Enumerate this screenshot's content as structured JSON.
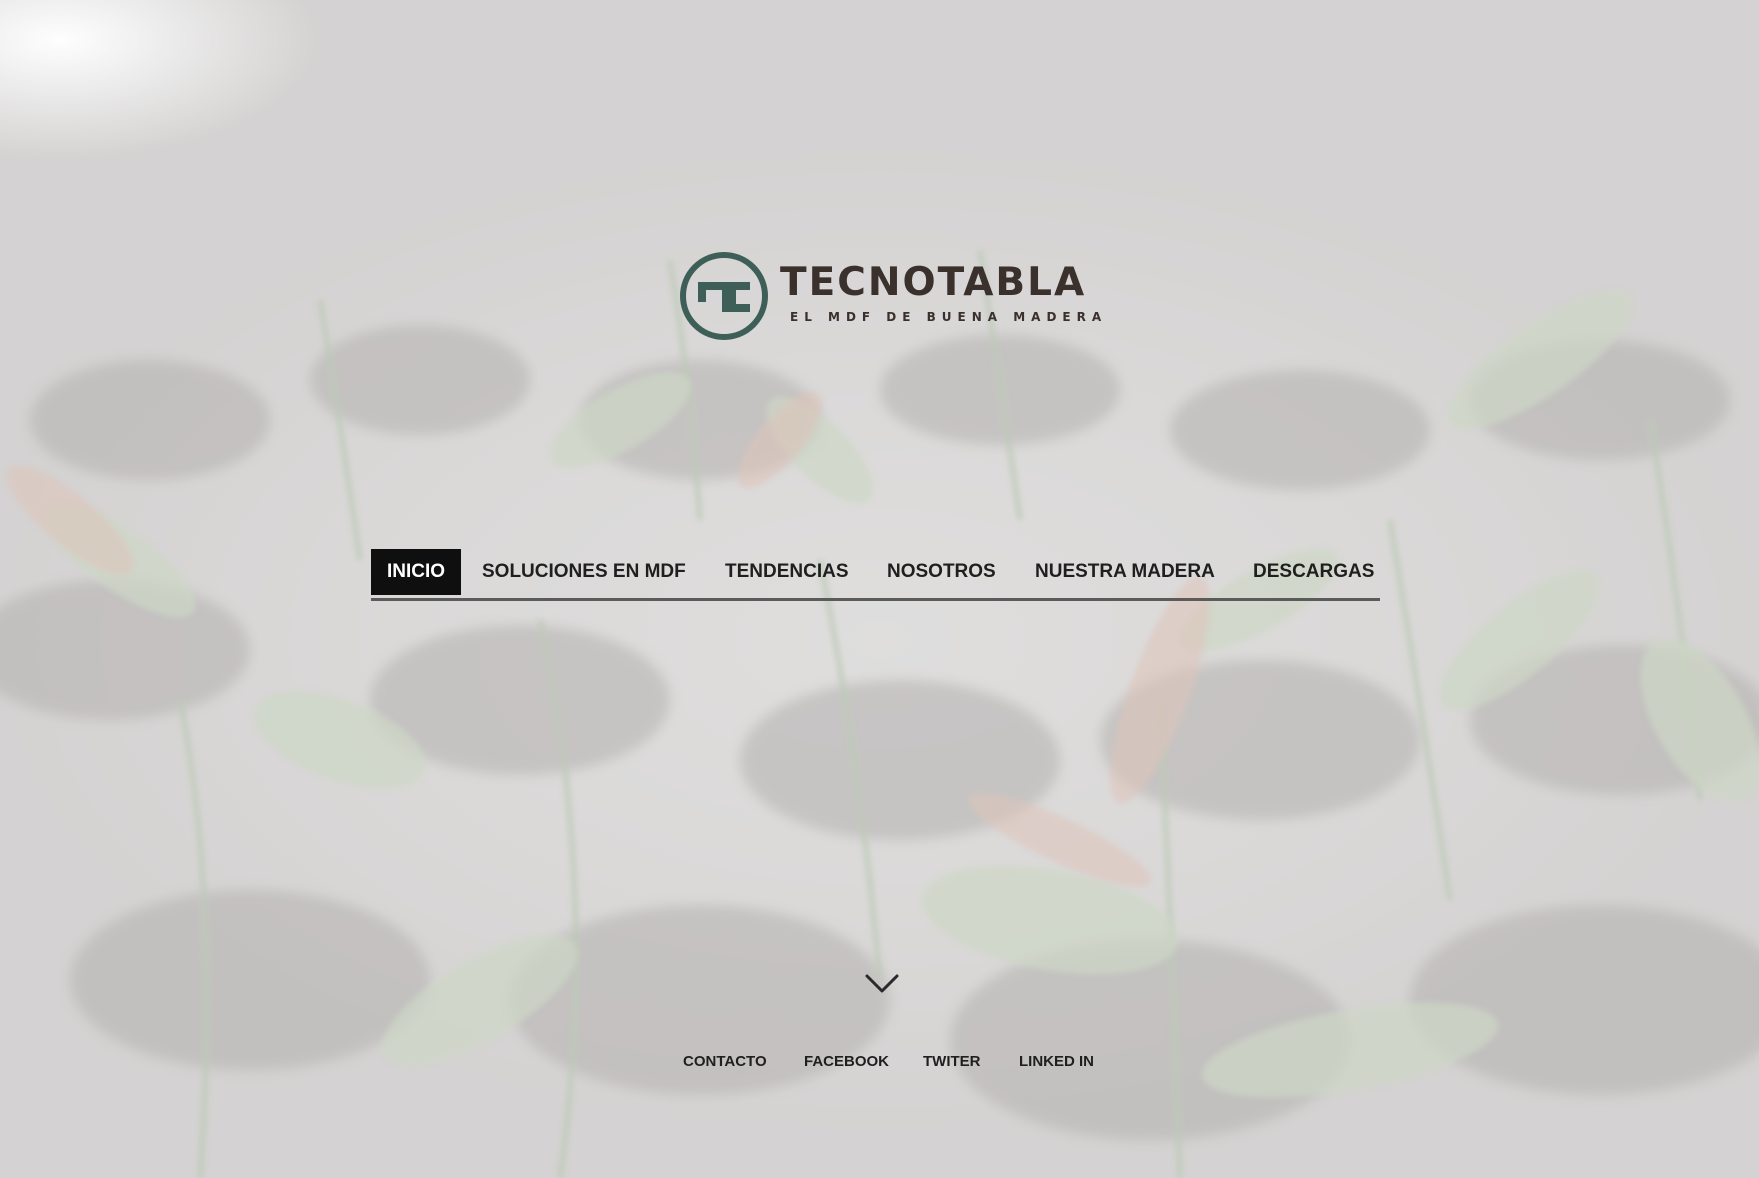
{
  "brand": {
    "name": "TECNOTABLA",
    "tagline": "EL MDF DE BUENA MADERA",
    "primary_color": "#3e5e58",
    "text_color": "#3a302c"
  },
  "nav": {
    "items": [
      {
        "label": "INICIO",
        "active": true
      },
      {
        "label": "SOLUCIONES EN MDF",
        "active": false
      },
      {
        "label": "TENDENCIAS",
        "active": false
      },
      {
        "label": "NOSOTROS",
        "active": false
      },
      {
        "label": "NUESTRA MADERA",
        "active": false
      },
      {
        "label": "DESCARGAS",
        "active": false
      }
    ],
    "active_bg": "#0f0f10"
  },
  "scroll_icon": "chevron-down-icon",
  "footer": {
    "links": [
      {
        "label": "CONTACTO"
      },
      {
        "label": "FACEBOOK"
      },
      {
        "label": "TWITER"
      },
      {
        "label": "LINKED IN"
      }
    ]
  }
}
